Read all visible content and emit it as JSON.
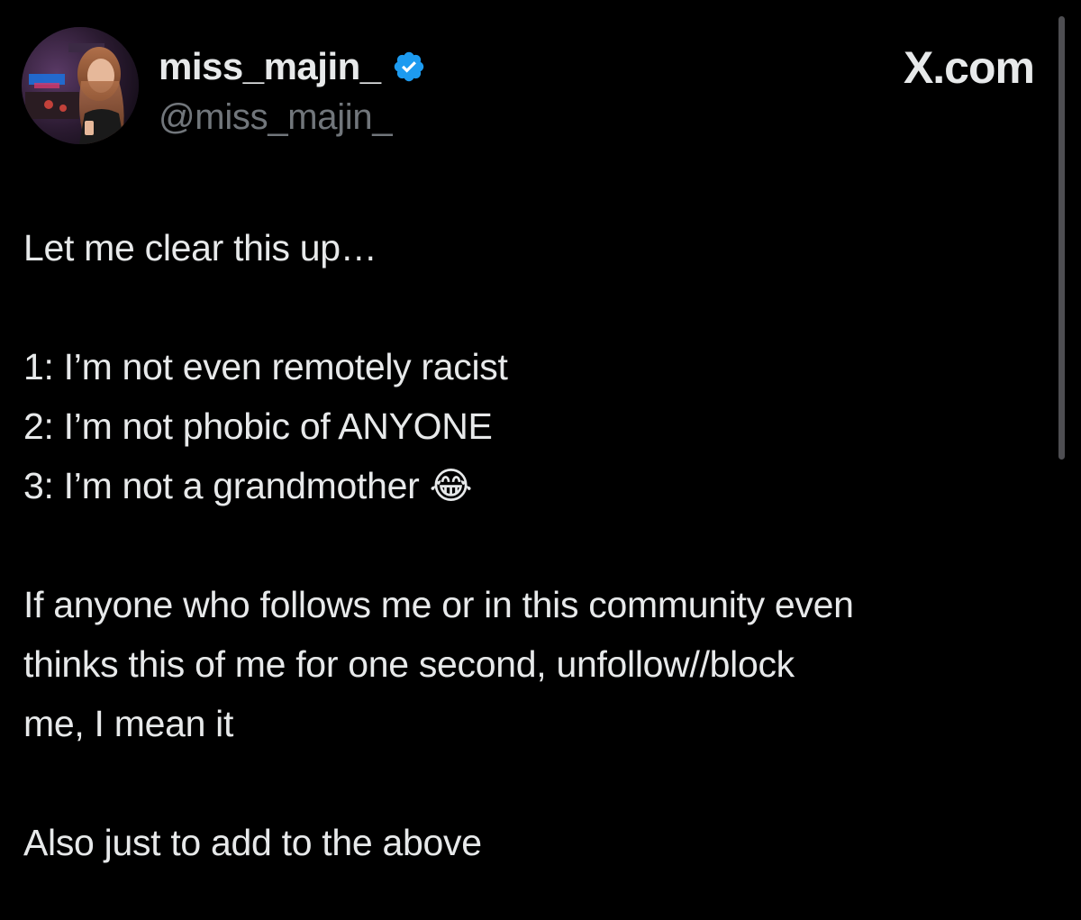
{
  "header": {
    "display_name": "miss_majin_",
    "handle": "@miss_majin_",
    "verified_icon": "verified-badge-icon",
    "source": "X.com"
  },
  "tweet": {
    "lines": [
      "Let me clear this up…",
      "",
      "1: I’m not even remotely racist",
      "2: I’m not phobic of ANYONE",
      "3: I’m not a grandmother 😂",
      "",
      "If anyone who follows me or in this community even",
      "thinks this of me for one second, unfollow//block",
      "me, I mean it",
      "",
      "Also just to add to the above"
    ]
  },
  "colors": {
    "background": "#000000",
    "text_primary": "#e7e9ea",
    "text_secondary": "#71767b",
    "verified_blue": "#1d9bf0"
  }
}
